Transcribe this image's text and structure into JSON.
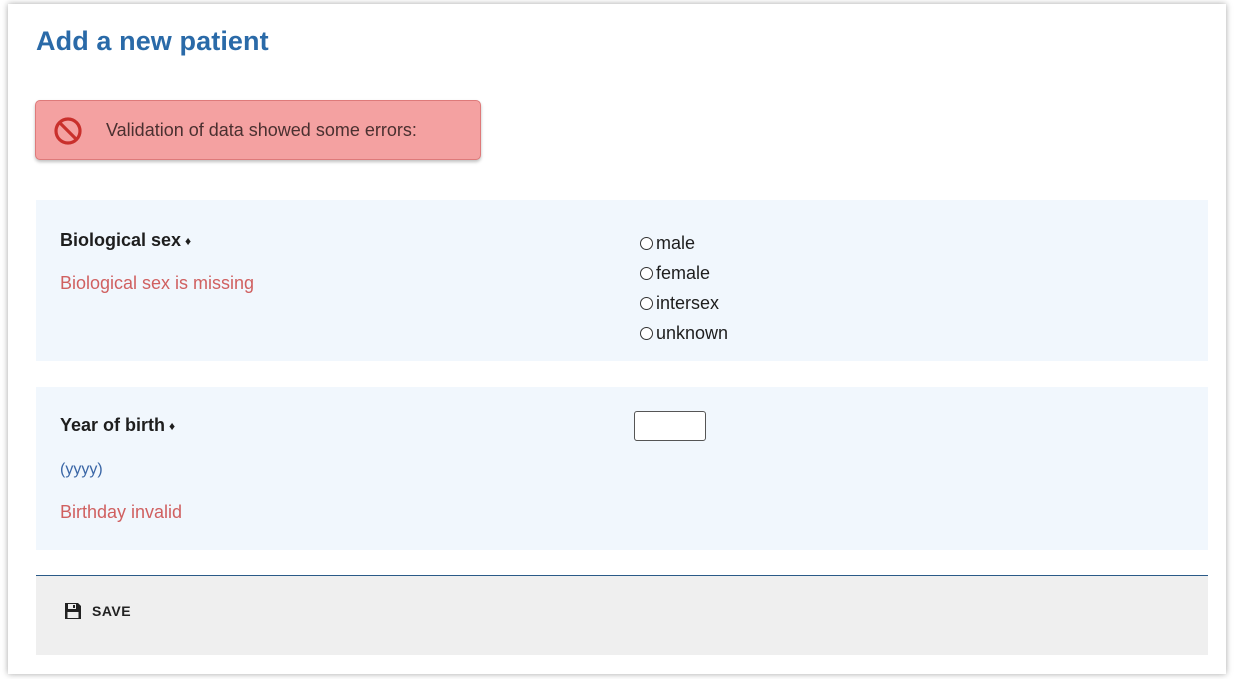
{
  "page": {
    "title": "Add a new patient"
  },
  "alert": {
    "icon": "prohibited-icon",
    "message": "Validation of data showed some errors:",
    "color": "#f4a1a1"
  },
  "sex_field": {
    "label": "Biological sex",
    "required_mark": "♦",
    "error": "Biological sex is missing",
    "options": [
      {
        "label": "male",
        "checked": false
      },
      {
        "label": "female",
        "checked": false
      },
      {
        "label": "intersex",
        "checked": false
      },
      {
        "label": "unknown",
        "checked": false
      }
    ]
  },
  "year_field": {
    "label": "Year of birth",
    "required_mark": "♦",
    "hint": "(yyyy)",
    "error": "Birthday invalid",
    "value": ""
  },
  "footer": {
    "save_icon": "floppy-disk-icon",
    "save_label": "SAVE"
  },
  "colors": {
    "title": "#2a6aa8",
    "error_text": "#d06060",
    "section_bg": "#f1f7fd"
  }
}
